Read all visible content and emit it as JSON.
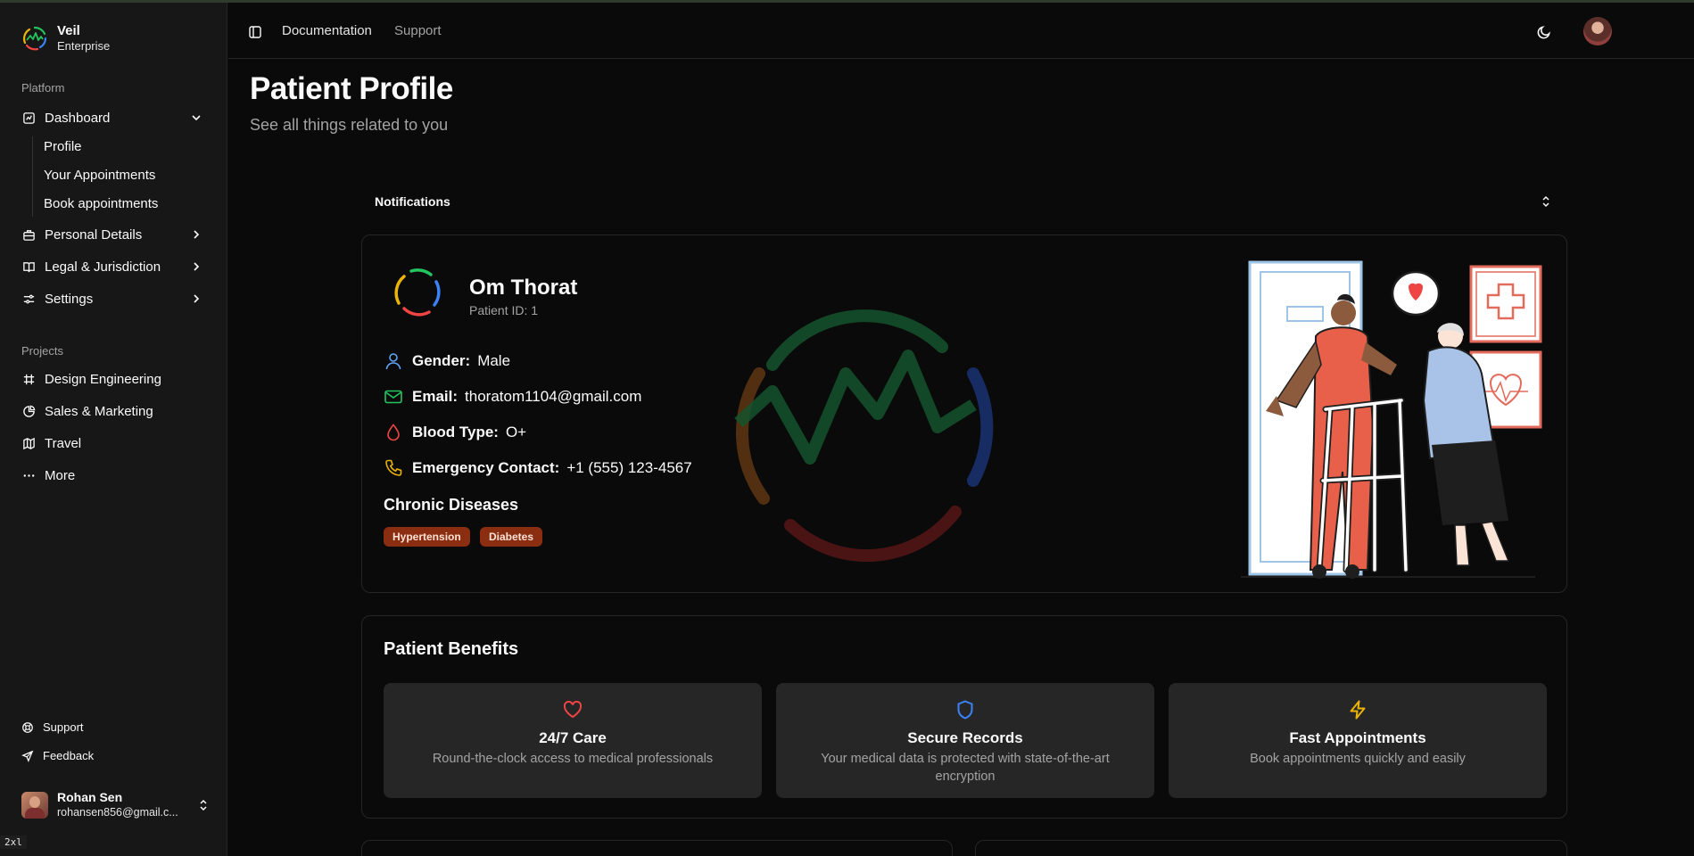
{
  "app": {
    "name": "Veil",
    "plan": "Enterprise"
  },
  "sidebar": {
    "platform_label": "Platform",
    "dashboard": {
      "label": "Dashboard",
      "sub_items": [
        "Profile",
        "Your Appointments",
        "Book appointments"
      ]
    },
    "personal_details": "Personal Details",
    "legal": "Legal & Jurisdiction",
    "settings": "Settings",
    "projects_label": "Projects",
    "projects": [
      "Design Engineering",
      "Sales & Marketing",
      "Travel",
      "More"
    ],
    "support": "Support",
    "feedback": "Feedback",
    "user": {
      "name": "Rohan Sen",
      "email": "rohansen856@gmail.c..."
    },
    "breakpoint_badge": "2xl"
  },
  "header": {
    "links": [
      "Documentation",
      "Support"
    ]
  },
  "page": {
    "title": "Patient Profile",
    "subtitle": "See all things related to you"
  },
  "notifications": {
    "label": "Notifications"
  },
  "patient": {
    "name": "Om Thorat",
    "id_text": "Patient ID: 1",
    "gender_label": "Gender:",
    "gender": "Male",
    "email_label": "Email:",
    "email": "thoratom1104@gmail.com",
    "blood_label": "Blood Type:",
    "blood": "O+",
    "emergency_label": "Emergency Contact:",
    "emergency": "+1 (555) 123-4567",
    "chronic_title": "Chronic Diseases",
    "chronic": [
      "Hypertension",
      "Diabetes"
    ]
  },
  "benefits": {
    "title": "Patient Benefits",
    "items": [
      {
        "icon": "heart-icon",
        "title": "24/7 Care",
        "desc": "Round-the-clock access to medical professionals",
        "color": "#ef4444"
      },
      {
        "icon": "shield-icon",
        "title": "Secure Records",
        "desc": "Your medical data is protected with state-of-the-art encryption",
        "color": "#3b82f6"
      },
      {
        "icon": "zap-icon",
        "title": "Fast Appointments",
        "desc": "Book appointments quickly and easily",
        "color": "#eab308"
      }
    ]
  },
  "colors": {
    "background": "#0a0a0a",
    "sidebar": "#171717",
    "tag": "#8a2d10",
    "benefit_tile": "#262626"
  }
}
